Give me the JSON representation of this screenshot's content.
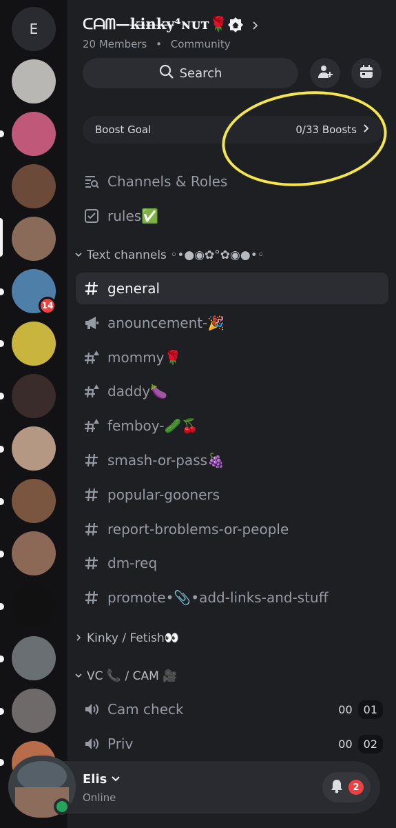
{
  "rail": {
    "home_label": "E",
    "servers": [
      {
        "name": "server-1",
        "color": "#b9b7b3"
      },
      {
        "name": "server-2",
        "color": "#c0587a"
      },
      {
        "name": "server-3",
        "color": "#6b4a3a"
      },
      {
        "name": "server-4",
        "color": "#8a6a58"
      },
      {
        "name": "server-5",
        "color": "#4e7fa8",
        "badge": "14"
      },
      {
        "name": "server-6",
        "color": "#c9b53e"
      },
      {
        "name": "server-7",
        "color": "#3a2c2a"
      },
      {
        "name": "server-8",
        "color": "#b59884"
      },
      {
        "name": "server-9",
        "color": "#7a5640"
      },
      {
        "name": "server-10",
        "color": "#8c6856"
      },
      {
        "name": "server-11",
        "color": "#111111"
      },
      {
        "name": "server-12",
        "color": "#6a6f74"
      },
      {
        "name": "server-13",
        "color": "#6e6a6a"
      },
      {
        "name": "server-14",
        "color": "#b86d4a"
      }
    ]
  },
  "server": {
    "title": "ᑕᗩᗰ—k̶i̶n̶k̶y̶⁴ɴᴜᴛ🌹",
    "members": "20 Members",
    "separator": "•",
    "type": "Community"
  },
  "search": {
    "label": "Search"
  },
  "boost": {
    "label": "Boost Goal",
    "status": "0/33 Boosts"
  },
  "top_links": [
    {
      "label": "Channels & Roles",
      "icon": "channels-roles-icon"
    },
    {
      "label": "rules✅",
      "icon": "rules-icon"
    }
  ],
  "categories": {
    "text": "Text channels ◦•●◉✿°✿◉●•◦",
    "kinky": "Kinky / Fetish👀",
    "vc": "VC 📞 / CAM 🎥"
  },
  "channels": [
    {
      "label": "general",
      "icon": "hash-icon",
      "active": true
    },
    {
      "label": "anouncement-🎉",
      "icon": "megaphone-icon"
    },
    {
      "label": "mommy🌹",
      "icon": "hash-warning-icon"
    },
    {
      "label": "daddy🍆",
      "icon": "hash-warning-icon"
    },
    {
      "label": "femboy-🥒🍒",
      "icon": "hash-warning-icon"
    },
    {
      "label": "smash-or-pass🍇",
      "icon": "hash-icon"
    },
    {
      "label": "popular-gooners",
      "icon": "hash-icon"
    },
    {
      "label": "report-broblems-or-people",
      "icon": "hash-icon"
    },
    {
      "label": "dm-req",
      "icon": "hash-icon"
    },
    {
      "label": "promote•📎•add-links-and-stuff",
      "icon": "hash-icon"
    }
  ],
  "voice": [
    {
      "label": "Cam check",
      "count": "00",
      "limit": "01",
      "icon": "speaker-icon"
    },
    {
      "label": "Priv",
      "count": "00",
      "limit": "02",
      "icon": "speaker-icon"
    }
  ],
  "user": {
    "name": "Elis",
    "status": "Online",
    "notifications": "2"
  },
  "colors": {
    "accent_highlight": "#f4e64b",
    "online": "#23a55a",
    "badge": "#f23f42"
  }
}
